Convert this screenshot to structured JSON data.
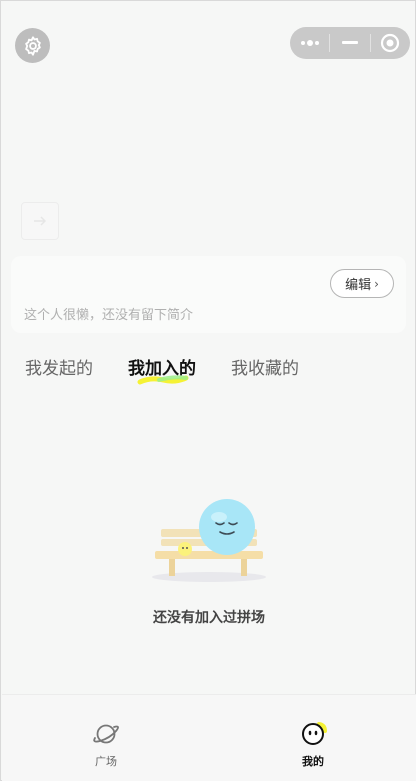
{
  "header": {
    "settings_icon": "gear-icon",
    "capsule": {
      "more_icon": "more-dots-icon",
      "minimize_icon": "minimize-icon",
      "close_icon": "target-circle-icon"
    }
  },
  "profile": {
    "edit_label": "编辑",
    "bio": "这个人很懒，还没有留下简介"
  },
  "tabs": [
    {
      "label": "我发起的",
      "active": false
    },
    {
      "label": "我加入的",
      "active": true
    },
    {
      "label": "我收藏的",
      "active": false
    }
  ],
  "empty_state": {
    "message": "还没有加入过拼场"
  },
  "tabbar": [
    {
      "label": "广场",
      "icon": "planet-icon",
      "active": false
    },
    {
      "label": "我的",
      "icon": "smiley-face-icon",
      "active": true
    }
  ],
  "colors": {
    "accent_yellow": "#f7f32a",
    "accent_green": "#9cf08a"
  }
}
